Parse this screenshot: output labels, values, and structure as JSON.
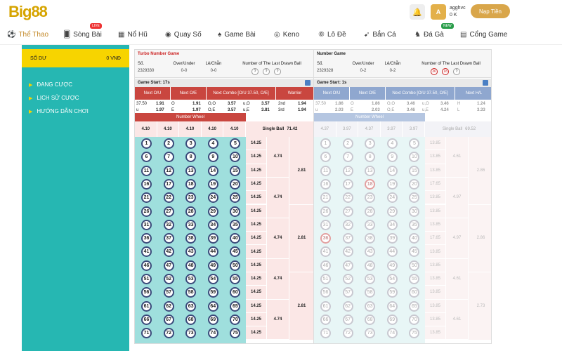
{
  "brand": {
    "logo": "Big88",
    "accent": "#d6a400"
  },
  "user": {
    "avatar": "A",
    "name": "agghvc",
    "balance": "0 K",
    "topup": "Nạp Tiền"
  },
  "nav": [
    {
      "label": "Thể Thao",
      "icon": "soccer-icon",
      "active": true,
      "badge": ""
    },
    {
      "label": "Sòng Bài",
      "icon": "casino-icon",
      "active": false,
      "badge": "LIVE"
    },
    {
      "label": "Nổ Hũ",
      "icon": "slot-icon",
      "active": false,
      "badge": ""
    },
    {
      "label": "Quay Số",
      "icon": "lottery-icon",
      "active": false,
      "badge": ""
    },
    {
      "label": "Game Bài",
      "icon": "cards-icon",
      "active": false,
      "badge": ""
    },
    {
      "label": "Keno",
      "icon": "keno-icon",
      "active": false,
      "badge": ""
    },
    {
      "label": "Lô Đề",
      "icon": "lode-icon",
      "active": false,
      "badge": ""
    },
    {
      "label": "Bắn Cá",
      "icon": "fish-icon",
      "active": false,
      "badge": ""
    },
    {
      "label": "Đá Gà",
      "icon": "rooster-icon",
      "active": false,
      "badge": "NEW"
    },
    {
      "label": "Cổng Game",
      "icon": "grid-icon",
      "active": false,
      "badge": ""
    }
  ],
  "sidebar": {
    "balance_label": "SỐ DƯ",
    "balance_value": "0 VNĐ",
    "items": [
      "ĐANG CƯỢC",
      "LỊCH SỬ CƯỢC",
      "HƯỚNG DẪN CHƠI"
    ]
  },
  "game1": {
    "name": "Turbo Number Game",
    "headers": [
      "Số.",
      "Over/Under",
      "Lẻ/Chẵn",
      "Number of The Last Drawn Ball"
    ],
    "values": [
      "2329330",
      "0-0",
      "0-0"
    ],
    "drawn": [
      "?",
      "?",
      "?"
    ],
    "start": "Game Start: 17s",
    "odds_headers": [
      "Next O/U",
      "Next O/E",
      "Next Combo [O/U 37.50, O/E]",
      "Warrior"
    ],
    "odds_rows": [
      [
        "37.50",
        "1.91",
        "O",
        "1.91",
        "O,O",
        "3.57",
        "u,O",
        "3.57",
        "2nd",
        "1.94"
      ],
      [
        "u",
        "1.97",
        "E",
        "1.97",
        "O,E",
        "3.57",
        "u,E",
        "3.81",
        "3rd",
        "1.94"
      ]
    ],
    "wheel_label": "Number Wheel",
    "wheel_values": [
      "4.10",
      "4.10",
      "4.10",
      "4.10",
      "4.10"
    ],
    "single_label": "Single Ball",
    "single_value": "71.42",
    "col_a": "14.25",
    "col_b": "4.74",
    "col_c": "2.81"
  },
  "game2": {
    "name": "Number Game",
    "headers": [
      "Số.",
      "Over/Under",
      "Lẻ/Chẵn",
      "Number of The Last Drawn Ball"
    ],
    "values": [
      "2329328",
      "0-2",
      "0-2"
    ],
    "drawn": [
      "36",
      "18",
      "?"
    ],
    "start": "Game Start: 1s",
    "odds_headers": [
      "Next O/U",
      "Next O/E",
      "Next Combo [O/U 37.50, O/E]",
      "Next H/L"
    ],
    "odds_rows": [
      [
        "37.50",
        "1.86",
        "O",
        "1.86",
        "O,O",
        "3.46",
        "u,O",
        "3.46",
        "H",
        "1.24"
      ],
      [
        "u",
        "2.03",
        "E",
        "2.03",
        "O,E",
        "3.46",
        "u,E",
        "4.24",
        "L",
        "3.33"
      ]
    ],
    "wheel_label": "Number Wheel",
    "wheel_values": [
      "4.37",
      "3.97",
      "4.37",
      "3.97",
      "3.97"
    ],
    "single_label": "Single Ball",
    "single_value": "69.52",
    "col_a": [
      "13.85",
      "13.85",
      "13.85",
      "17.65",
      "13.85",
      "13.85",
      "13.85",
      "17.65",
      "13.85",
      "13.85",
      "13.85",
      "13.85",
      "13.85",
      "13.85",
      "13.85"
    ],
    "col_b": [
      "4.61",
      "4.97",
      "4.97",
      "4.61",
      "4.61"
    ],
    "col_c": [
      "2.86",
      "2.86",
      "2.73"
    ]
  },
  "highlight_balls": [
    18,
    36
  ]
}
